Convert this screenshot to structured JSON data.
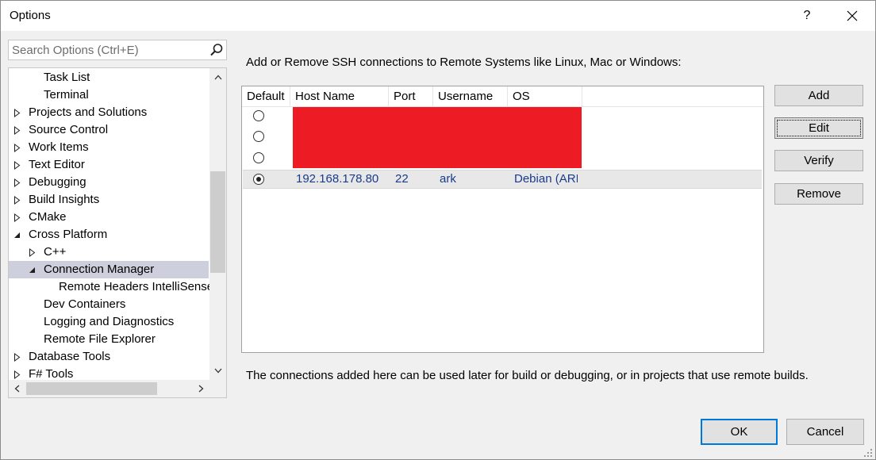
{
  "window": {
    "title": "Options",
    "help_label": "?",
    "close_label": "✕"
  },
  "search": {
    "placeholder": "Search Options (Ctrl+E)"
  },
  "tree": {
    "items": [
      {
        "label": "Task List",
        "level": 1,
        "expander": "none",
        "selected": false
      },
      {
        "label": "Terminal",
        "level": 1,
        "expander": "none",
        "selected": false
      },
      {
        "label": "Projects and Solutions",
        "level": 0,
        "expander": "collapsed",
        "selected": false
      },
      {
        "label": "Source Control",
        "level": 0,
        "expander": "collapsed",
        "selected": false
      },
      {
        "label": "Work Items",
        "level": 0,
        "expander": "collapsed",
        "selected": false
      },
      {
        "label": "Text Editor",
        "level": 0,
        "expander": "collapsed",
        "selected": false
      },
      {
        "label": "Debugging",
        "level": 0,
        "expander": "collapsed",
        "selected": false
      },
      {
        "label": "Build Insights",
        "level": 0,
        "expander": "collapsed",
        "selected": false
      },
      {
        "label": "CMake",
        "level": 0,
        "expander": "collapsed",
        "selected": false
      },
      {
        "label": "Cross Platform",
        "level": 0,
        "expander": "expanded",
        "selected": false
      },
      {
        "label": "C++",
        "level": 1,
        "expander": "collapsed",
        "selected": false
      },
      {
        "label": "Connection Manager",
        "level": 1,
        "expander": "expanded",
        "selected": true
      },
      {
        "label": "Remote Headers IntelliSense",
        "level": 2,
        "expander": "none",
        "selected": false
      },
      {
        "label": "Dev Containers",
        "level": 1,
        "expander": "none",
        "selected": false
      },
      {
        "label": "Logging and Diagnostics",
        "level": 1,
        "expander": "none",
        "selected": false
      },
      {
        "label": "Remote File Explorer",
        "level": 1,
        "expander": "none",
        "selected": false
      },
      {
        "label": "Database Tools",
        "level": 0,
        "expander": "collapsed",
        "selected": false
      },
      {
        "label": "F# Tools",
        "level": 0,
        "expander": "collapsed",
        "selected": false
      }
    ]
  },
  "connections": {
    "heading": "Add or Remove SSH connections to Remote Systems like Linux, Mac or Windows:",
    "columns": [
      "Default",
      "Host Name",
      "Port",
      "Username",
      "OS"
    ],
    "rows": [
      {
        "default": false,
        "host": "",
        "port": "",
        "username": "",
        "os": "",
        "redacted": true
      },
      {
        "default": false,
        "host": "",
        "port": "",
        "username": "",
        "os": "",
        "redacted": true
      },
      {
        "default": false,
        "host": "",
        "port": "",
        "username": "",
        "os": "",
        "redacted": true
      },
      {
        "default": true,
        "host": "192.168.178.80",
        "port": "22",
        "username": "ark",
        "os": "Debian (ARI",
        "redacted": false
      }
    ],
    "footer_note": "The connections added here can be used later for build or debugging, or in projects that use remote builds.",
    "redaction_color": "#ed1c24"
  },
  "buttons": {
    "add": "Add",
    "edit": "Edit",
    "verify": "Verify",
    "remove": "Remove",
    "ok": "OK",
    "cancel": "Cancel"
  },
  "colors": {
    "accent": "#0078d7",
    "selection": "#cdd0dc",
    "value_text": "#1a3b8a"
  }
}
